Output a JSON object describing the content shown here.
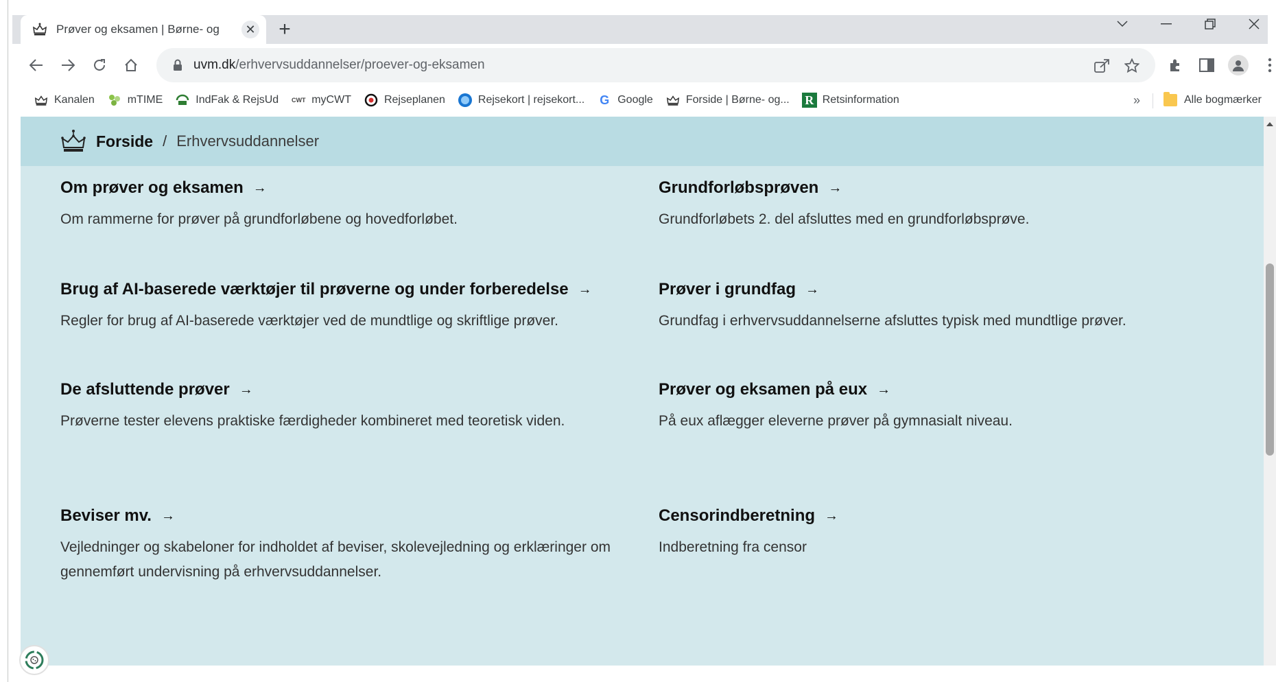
{
  "browser": {
    "tab_title": "Prøver og eksamen | Børne- og",
    "tab_close": "✕",
    "new_tab": "+",
    "url_host": "uvm.dk",
    "url_path": "/erhvervsuddannelser/proever-og-eksamen",
    "bookmarks": [
      {
        "label": "Kanalen",
        "icon": "crown-icon"
      },
      {
        "label": "mTIME",
        "icon": "mtime-icon"
      },
      {
        "label": "IndFak & RejsUd",
        "icon": "indfak-icon"
      },
      {
        "label": "myCWT",
        "icon": "cwt-icon"
      },
      {
        "label": "Rejseplanen",
        "icon": "rejseplanen-icon"
      },
      {
        "label": "Rejsekort | rejsekort...",
        "icon": "rejsekort-icon"
      },
      {
        "label": "Google",
        "icon": "google-icon"
      },
      {
        "label": "Forside | Børne- og...",
        "icon": "crown-icon"
      },
      {
        "label": "Retsinformation",
        "icon": "retsinformation-icon"
      }
    ],
    "bookmarks_more": "»",
    "all_bookmarks": "Alle bogmærker",
    "cwt_text": "CWT",
    "google_letter": "G",
    "retsinfo_letter": "R"
  },
  "breadcrumb": {
    "home": "Forside",
    "separator": "/",
    "current": "Erhvervsuddannelser"
  },
  "items": [
    {
      "title": "Om prøver og eksamen",
      "desc": "Om rammerne for prøver på grundforløbene og hovedforløbet."
    },
    {
      "title": "Grundforløbsprøven",
      "desc": "Grundforløbets 2. del afsluttes med en grundforløbsprøve."
    },
    {
      "title": "Brug af AI-baserede værktøjer til prøverne og under forberedelse",
      "desc": "Regler for brug af AI-baserede værktøjer ved de mundtlige og skriftlige prøver."
    },
    {
      "title": "Prøver i grundfag",
      "desc": "Grundfag i erhvervsuddannelserne afsluttes typisk med mundtlige prøver."
    },
    {
      "title": "De afsluttende prøver",
      "desc": "Prøverne tester elevens praktiske færdigheder kombineret med teoretisk viden."
    },
    {
      "title": "Prøver og eksamen på eux",
      "desc": "På eux aflægger eleverne prøver på gymnasialt niveau."
    },
    {
      "title": "Beviser mv.",
      "desc": "Vejledninger og skabeloner for indholdet af beviser, skolevejledning og erklæringer om gennemført undervisning på erhvervsuddannelser."
    },
    {
      "title": "Censorindberetning",
      "desc": "Indberetning fra censor"
    }
  ],
  "arrow": "→"
}
